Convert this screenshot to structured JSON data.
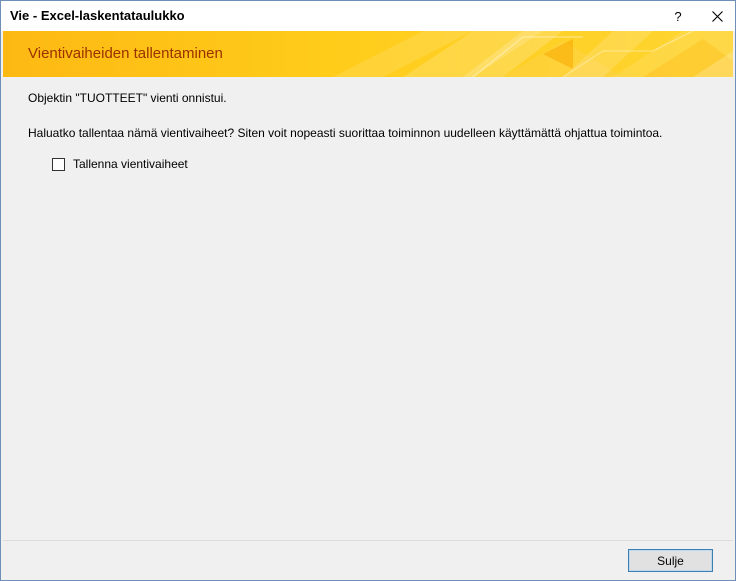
{
  "window": {
    "title": "Vie - Excel-laskentataulukko",
    "help_label": "?"
  },
  "banner": {
    "title": "Vientivaiheiden tallentaminen"
  },
  "content": {
    "message": "Objektin \"TUOTTEET\" vienti onnistui.",
    "question": "Haluatko tallentaa nämä vientivaiheet? Siten voit nopeasti suorittaa toiminnon uudelleen käyttämättä ohjattua toimintoa.",
    "save_checkbox": {
      "label": "Tallenna vientivaiheet",
      "checked": false
    }
  },
  "footer": {
    "close_button": "Sulje"
  },
  "colors": {
    "banner_gradient_start": "#fdb913",
    "banner_gradient_end": "#fed531",
    "banner_title": "#9a3100",
    "dialog_bg": "#f0f0f0",
    "button_border": "#3c7fb1"
  }
}
